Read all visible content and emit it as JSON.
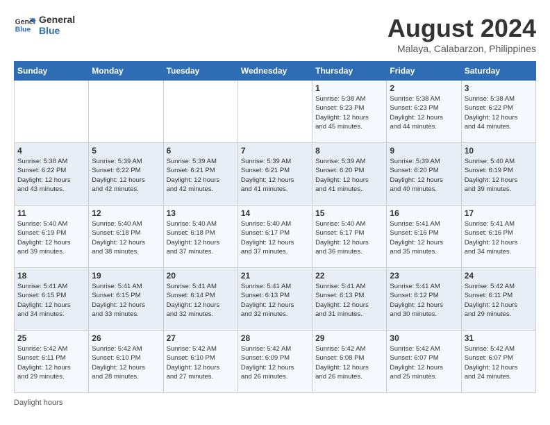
{
  "header": {
    "logo_line1": "General",
    "logo_line2": "Blue",
    "month_title": "August 2024",
    "subtitle": "Malaya, Calabarzon, Philippines"
  },
  "weekdays": [
    "Sunday",
    "Monday",
    "Tuesday",
    "Wednesday",
    "Thursday",
    "Friday",
    "Saturday"
  ],
  "weeks": [
    [
      {
        "day": "",
        "info": ""
      },
      {
        "day": "",
        "info": ""
      },
      {
        "day": "",
        "info": ""
      },
      {
        "day": "",
        "info": ""
      },
      {
        "day": "1",
        "info": "Sunrise: 5:38 AM\nSunset: 6:23 PM\nDaylight: 12 hours\nand 45 minutes."
      },
      {
        "day": "2",
        "info": "Sunrise: 5:38 AM\nSunset: 6:23 PM\nDaylight: 12 hours\nand 44 minutes."
      },
      {
        "day": "3",
        "info": "Sunrise: 5:38 AM\nSunset: 6:22 PM\nDaylight: 12 hours\nand 44 minutes."
      }
    ],
    [
      {
        "day": "4",
        "info": "Sunrise: 5:38 AM\nSunset: 6:22 PM\nDaylight: 12 hours\nand 43 minutes."
      },
      {
        "day": "5",
        "info": "Sunrise: 5:39 AM\nSunset: 6:22 PM\nDaylight: 12 hours\nand 42 minutes."
      },
      {
        "day": "6",
        "info": "Sunrise: 5:39 AM\nSunset: 6:21 PM\nDaylight: 12 hours\nand 42 minutes."
      },
      {
        "day": "7",
        "info": "Sunrise: 5:39 AM\nSunset: 6:21 PM\nDaylight: 12 hours\nand 41 minutes."
      },
      {
        "day": "8",
        "info": "Sunrise: 5:39 AM\nSunset: 6:20 PM\nDaylight: 12 hours\nand 41 minutes."
      },
      {
        "day": "9",
        "info": "Sunrise: 5:39 AM\nSunset: 6:20 PM\nDaylight: 12 hours\nand 40 minutes."
      },
      {
        "day": "10",
        "info": "Sunrise: 5:40 AM\nSunset: 6:19 PM\nDaylight: 12 hours\nand 39 minutes."
      }
    ],
    [
      {
        "day": "11",
        "info": "Sunrise: 5:40 AM\nSunset: 6:19 PM\nDaylight: 12 hours\nand 39 minutes."
      },
      {
        "day": "12",
        "info": "Sunrise: 5:40 AM\nSunset: 6:18 PM\nDaylight: 12 hours\nand 38 minutes."
      },
      {
        "day": "13",
        "info": "Sunrise: 5:40 AM\nSunset: 6:18 PM\nDaylight: 12 hours\nand 37 minutes."
      },
      {
        "day": "14",
        "info": "Sunrise: 5:40 AM\nSunset: 6:17 PM\nDaylight: 12 hours\nand 37 minutes."
      },
      {
        "day": "15",
        "info": "Sunrise: 5:40 AM\nSunset: 6:17 PM\nDaylight: 12 hours\nand 36 minutes."
      },
      {
        "day": "16",
        "info": "Sunrise: 5:41 AM\nSunset: 6:16 PM\nDaylight: 12 hours\nand 35 minutes."
      },
      {
        "day": "17",
        "info": "Sunrise: 5:41 AM\nSunset: 6:16 PM\nDaylight: 12 hours\nand 34 minutes."
      }
    ],
    [
      {
        "day": "18",
        "info": "Sunrise: 5:41 AM\nSunset: 6:15 PM\nDaylight: 12 hours\nand 34 minutes."
      },
      {
        "day": "19",
        "info": "Sunrise: 5:41 AM\nSunset: 6:15 PM\nDaylight: 12 hours\nand 33 minutes."
      },
      {
        "day": "20",
        "info": "Sunrise: 5:41 AM\nSunset: 6:14 PM\nDaylight: 12 hours\nand 32 minutes."
      },
      {
        "day": "21",
        "info": "Sunrise: 5:41 AM\nSunset: 6:13 PM\nDaylight: 12 hours\nand 32 minutes."
      },
      {
        "day": "22",
        "info": "Sunrise: 5:41 AM\nSunset: 6:13 PM\nDaylight: 12 hours\nand 31 minutes."
      },
      {
        "day": "23",
        "info": "Sunrise: 5:41 AM\nSunset: 6:12 PM\nDaylight: 12 hours\nand 30 minutes."
      },
      {
        "day": "24",
        "info": "Sunrise: 5:42 AM\nSunset: 6:11 PM\nDaylight: 12 hours\nand 29 minutes."
      }
    ],
    [
      {
        "day": "25",
        "info": "Sunrise: 5:42 AM\nSunset: 6:11 PM\nDaylight: 12 hours\nand 29 minutes."
      },
      {
        "day": "26",
        "info": "Sunrise: 5:42 AM\nSunset: 6:10 PM\nDaylight: 12 hours\nand 28 minutes."
      },
      {
        "day": "27",
        "info": "Sunrise: 5:42 AM\nSunset: 6:10 PM\nDaylight: 12 hours\nand 27 minutes."
      },
      {
        "day": "28",
        "info": "Sunrise: 5:42 AM\nSunset: 6:09 PM\nDaylight: 12 hours\nand 26 minutes."
      },
      {
        "day": "29",
        "info": "Sunrise: 5:42 AM\nSunset: 6:08 PM\nDaylight: 12 hours\nand 26 minutes."
      },
      {
        "day": "30",
        "info": "Sunrise: 5:42 AM\nSunset: 6:07 PM\nDaylight: 12 hours\nand 25 minutes."
      },
      {
        "day": "31",
        "info": "Sunrise: 5:42 AM\nSunset: 6:07 PM\nDaylight: 12 hours\nand 24 minutes."
      }
    ]
  ],
  "footer": {
    "daylight_label": "Daylight hours"
  }
}
